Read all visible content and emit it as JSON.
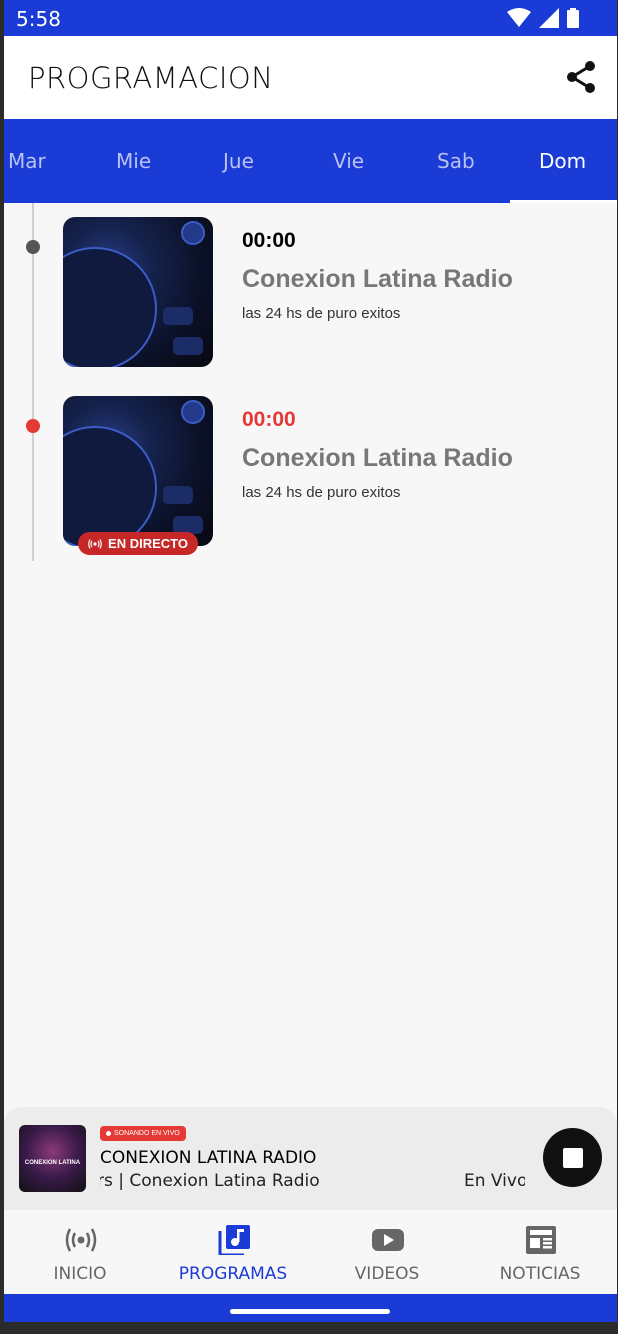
{
  "status_bar": {
    "time": "5:58"
  },
  "app_bar": {
    "title": "PROGRAMACION"
  },
  "day_tabs": [
    {
      "label": "Mar"
    },
    {
      "label": "Mie"
    },
    {
      "label": "Jue"
    },
    {
      "label": "Vie"
    },
    {
      "label": "Sab"
    },
    {
      "label": "Dom",
      "selected": true
    }
  ],
  "programs": [
    {
      "time": "00:00",
      "title": "Conexion Latina Radio",
      "description": "las 24 hs de puro exitos",
      "live": false
    },
    {
      "time": "00:00",
      "title": "Conexion Latina Radio",
      "description": "las 24 hs de puro exitos",
      "live": true,
      "live_badge": "EN DIRECTO"
    }
  ],
  "mini_player": {
    "badge": "SONANDO EN VIVO",
    "title": "CONEXION LATINA RADIO",
    "subtitle_left": "Irs | Conexion Latina Radio",
    "subtitle_right": "En Vivo",
    "art_text": "CONEXION LATINA"
  },
  "bottom_nav": [
    {
      "label": "INICIO",
      "icon": "broadcast-icon"
    },
    {
      "label": "PROGRAMAS",
      "icon": "music-library-icon",
      "active": true
    },
    {
      "label": "VIDEOS",
      "icon": "youtube-icon"
    },
    {
      "label": "NOTICIAS",
      "icon": "newspaper-icon"
    }
  ],
  "colors": {
    "primary": "#1b3bd6",
    "live_red": "#e53935",
    "badge_red": "#c62828"
  }
}
